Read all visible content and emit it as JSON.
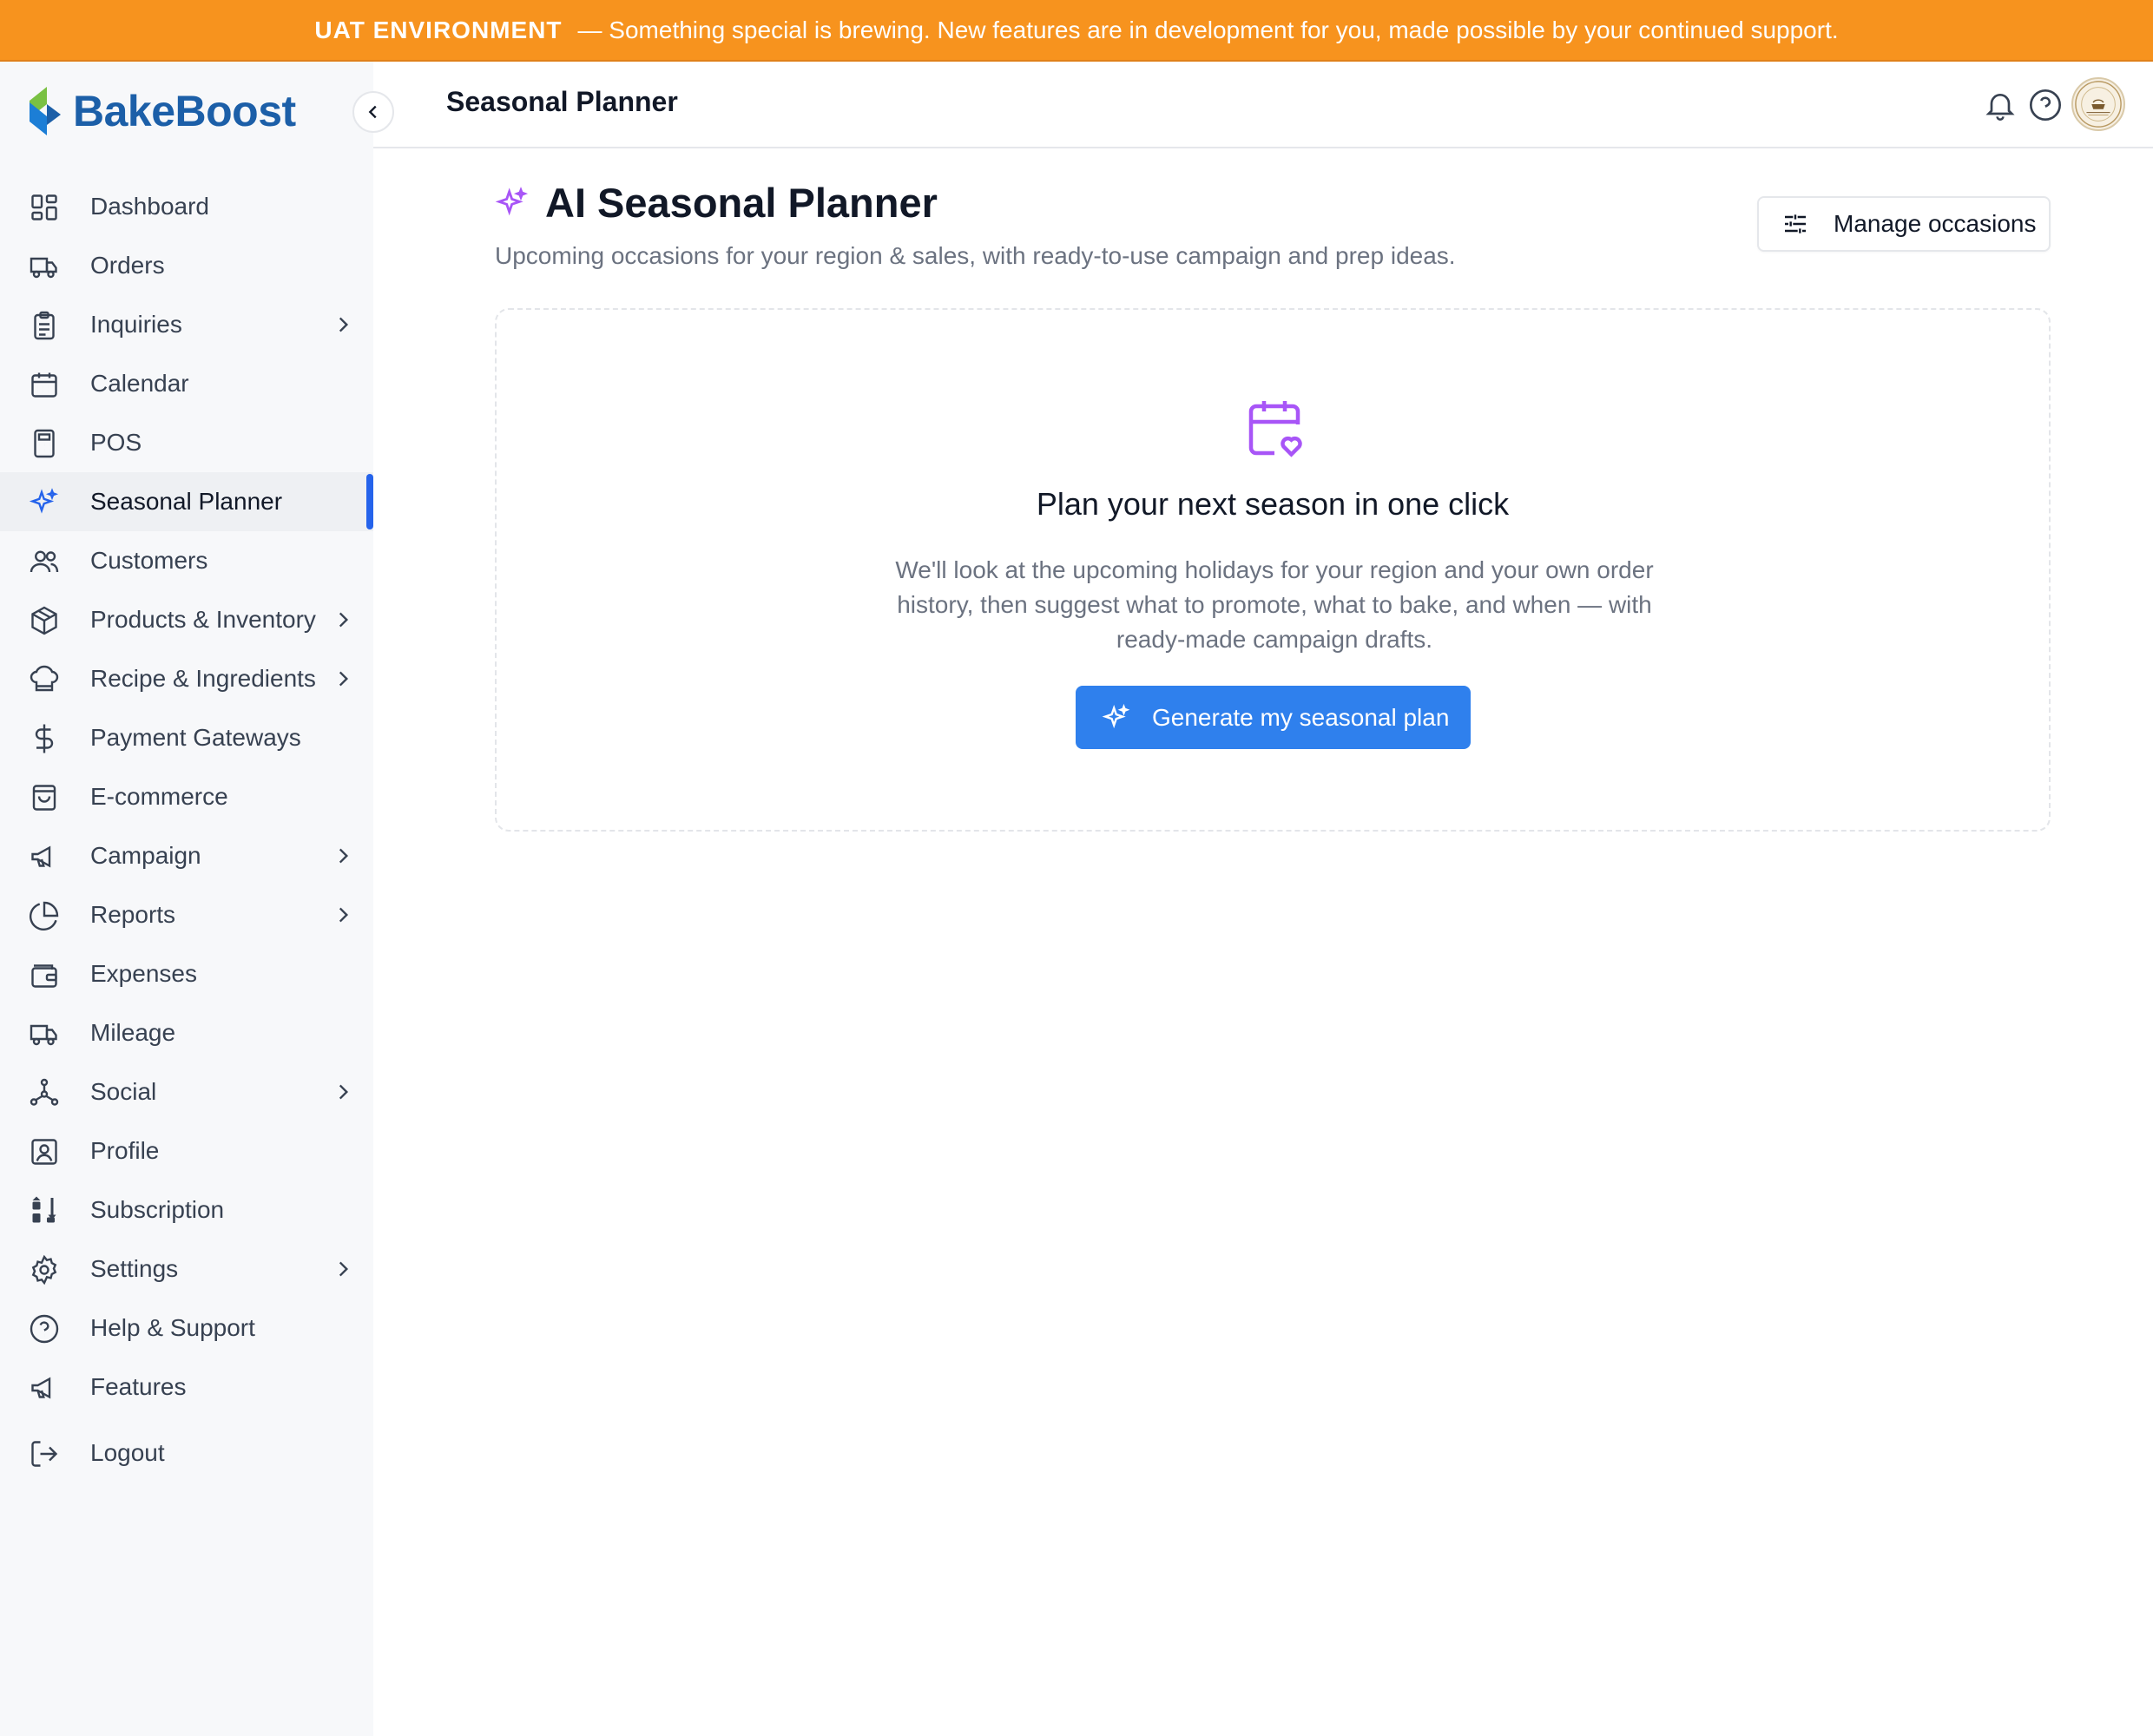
{
  "banner": {
    "strong": "UAT ENVIRONMENT",
    "message": "— Something special is brewing. New features are in development for you, made possible by your continued support."
  },
  "brand": {
    "name": "BakeBoost"
  },
  "sidebar": {
    "items": [
      {
        "label": "Dashboard",
        "icon": "dashboard-icon"
      },
      {
        "label": "Orders",
        "icon": "truck-icon"
      },
      {
        "label": "Inquiries",
        "icon": "clipboard-icon",
        "has_children": true
      },
      {
        "label": "Calendar",
        "icon": "calendar-icon"
      },
      {
        "label": "POS",
        "icon": "calculator-icon"
      },
      {
        "label": "Seasonal Planner",
        "icon": "sparkles-icon",
        "active": true
      },
      {
        "label": "Customers",
        "icon": "users-icon"
      },
      {
        "label": "Products & Inventory",
        "icon": "box-icon",
        "has_children": true
      },
      {
        "label": "Recipe & Ingredients",
        "icon": "chef-hat-icon",
        "has_children": true
      },
      {
        "label": "Payment Gateways",
        "icon": "dollar-icon"
      },
      {
        "label": "E-commerce",
        "icon": "shopping-bag-icon"
      },
      {
        "label": "Campaign",
        "icon": "megaphone-icon",
        "has_children": true
      },
      {
        "label": "Reports",
        "icon": "pie-chart-icon",
        "has_children": true
      },
      {
        "label": "Expenses",
        "icon": "wallet-icon"
      },
      {
        "label": "Mileage",
        "icon": "truck-icon"
      },
      {
        "label": "Social",
        "icon": "share-nodes-icon",
        "has_children": true
      },
      {
        "label": "Profile",
        "icon": "user-square-icon"
      },
      {
        "label": "Subscription",
        "icon": "sort-arrows-icon"
      },
      {
        "label": "Settings",
        "icon": "gear-icon",
        "has_children": true
      },
      {
        "label": "Help & Support",
        "icon": "help-circle-icon"
      },
      {
        "label": "Features",
        "icon": "megaphone-icon"
      },
      {
        "label": "Logout",
        "icon": "logout-icon"
      }
    ]
  },
  "header": {
    "title": "Seasonal Planner"
  },
  "main": {
    "title": "AI Seasonal Planner",
    "subtitle": "Upcoming occasions for your region & sales, with ready-to-use campaign and prep ideas.",
    "manage_button": "Manage occasions",
    "empty_state": {
      "title": "Plan your next season in one click",
      "description": "We'll look at the upcoming holidays for your region and your own order history, then suggest what to promote, what to bake, and when — with ready-made campaign drafts.",
      "button": "Generate my seasonal plan"
    }
  },
  "colors": {
    "banner": "#f7931e",
    "brand": "#1c5fa8",
    "accent": "#2f80ed",
    "active_indicator": "#2563eb",
    "sparkle": "#a855f7"
  }
}
